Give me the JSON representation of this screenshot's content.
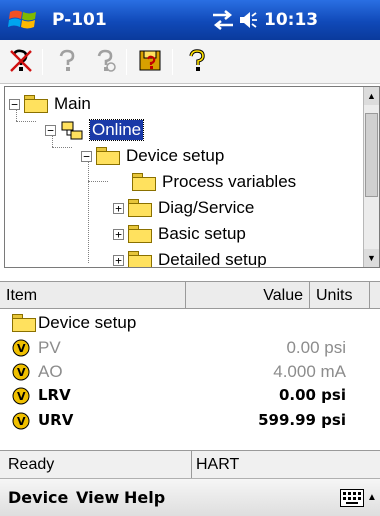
{
  "titlebar": {
    "title": "P-101",
    "clock": "10:13"
  },
  "toolbar": {
    "icons": [
      "offline-device-icon",
      "help-disabled-icon",
      "help-disabled-icon",
      "save-device-icon",
      "help-icon"
    ]
  },
  "tree": {
    "nodes": [
      {
        "label": "Main",
        "expander": "−"
      },
      {
        "label": "Online",
        "expander": "−",
        "selected": true
      },
      {
        "label": "Device setup",
        "expander": "−"
      },
      {
        "label": "Process variables"
      },
      {
        "label": "Diag/Service",
        "expander": "+"
      },
      {
        "label": "Basic setup",
        "expander": "+"
      },
      {
        "label": "Detailed setup",
        "expander": "+"
      }
    ]
  },
  "list": {
    "columns": {
      "item": "Item",
      "value": "Value",
      "units": "Units"
    },
    "folder_row": "Device setup",
    "rows": [
      {
        "name": "PV",
        "value": "0.00 psi"
      },
      {
        "name": "AO",
        "value": "4.000 mA"
      },
      {
        "name": "LRV",
        "value": "0.00 psi"
      },
      {
        "name": "URV",
        "value": "599.99 psi"
      }
    ]
  },
  "status": {
    "left": "Ready",
    "right": "HART"
  },
  "menu": {
    "device": "Device",
    "view": "View",
    "help": "Help"
  },
  "colors": {
    "titlebar": "#1049b8",
    "selection": "#1a3aa8",
    "folder": "#ffe15e"
  }
}
